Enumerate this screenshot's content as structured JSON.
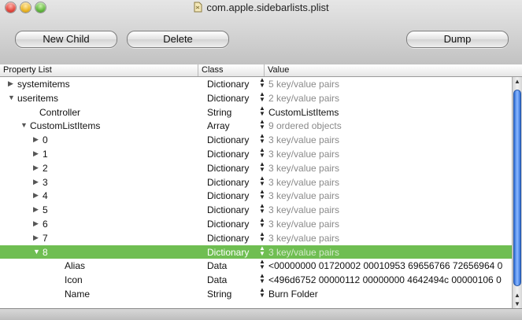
{
  "window": {
    "title": "com.apple.sidebarlists.plist"
  },
  "toolbar": {
    "new_child": "New Child",
    "delete": "Delete",
    "dump": "Dump"
  },
  "columns": {
    "property": "Property List",
    "class": "Class",
    "value": "Value"
  },
  "rows": [
    {
      "name": "systemitems",
      "indent": 22,
      "tri": "▶",
      "cls": "Dictionary",
      "val": "5 key/value pairs",
      "gray": true
    },
    {
      "name": "useritems",
      "indent": 22,
      "tri": "▼",
      "cls": "Dictionary",
      "val": "2 key/value pairs",
      "gray": true
    },
    {
      "name": "Controller",
      "indent": 50,
      "tri": "",
      "cls": "String",
      "val": "CustomListItems",
      "gray": false
    },
    {
      "name": "CustomListItems",
      "indent": 38,
      "tri": "▼",
      "cls": "Array",
      "val": "9 ordered objects",
      "gray": true
    },
    {
      "name": "0",
      "indent": 54,
      "tri": "▶",
      "cls": "Dictionary",
      "val": "3 key/value pairs",
      "gray": true
    },
    {
      "name": "1",
      "indent": 54,
      "tri": "▶",
      "cls": "Dictionary",
      "val": "3 key/value pairs",
      "gray": true
    },
    {
      "name": "2",
      "indent": 54,
      "tri": "▶",
      "cls": "Dictionary",
      "val": "3 key/value pairs",
      "gray": true
    },
    {
      "name": "3",
      "indent": 54,
      "tri": "▶",
      "cls": "Dictionary",
      "val": "3 key/value pairs",
      "gray": true
    },
    {
      "name": "4",
      "indent": 54,
      "tri": "▶",
      "cls": "Dictionary",
      "val": "3 key/value pairs",
      "gray": true
    },
    {
      "name": "5",
      "indent": 54,
      "tri": "▶",
      "cls": "Dictionary",
      "val": "3 key/value pairs",
      "gray": true
    },
    {
      "name": "6",
      "indent": 54,
      "tri": "▶",
      "cls": "Dictionary",
      "val": "3 key/value pairs",
      "gray": true
    },
    {
      "name": "7",
      "indent": 54,
      "tri": "▶",
      "cls": "Dictionary",
      "val": "3 key/value pairs",
      "gray": true
    },
    {
      "name": "8",
      "indent": 54,
      "tri": "▼",
      "cls": "Dictionary",
      "val": "3 key/value pairs",
      "gray": true,
      "selected": true
    },
    {
      "name": "Alias",
      "indent": 82,
      "tri": "",
      "cls": "Data",
      "val": "<00000000 01720002 00010953 69656766 72656964 0",
      "gray": false
    },
    {
      "name": "Icon",
      "indent": 82,
      "tri": "",
      "cls": "Data",
      "val": "<496d6752 00000112 00000000 4642494c 00000106 0",
      "gray": false
    },
    {
      "name": "Name",
      "indent": 82,
      "tri": "",
      "cls": "String",
      "val": "Burn Folder",
      "gray": false
    }
  ]
}
